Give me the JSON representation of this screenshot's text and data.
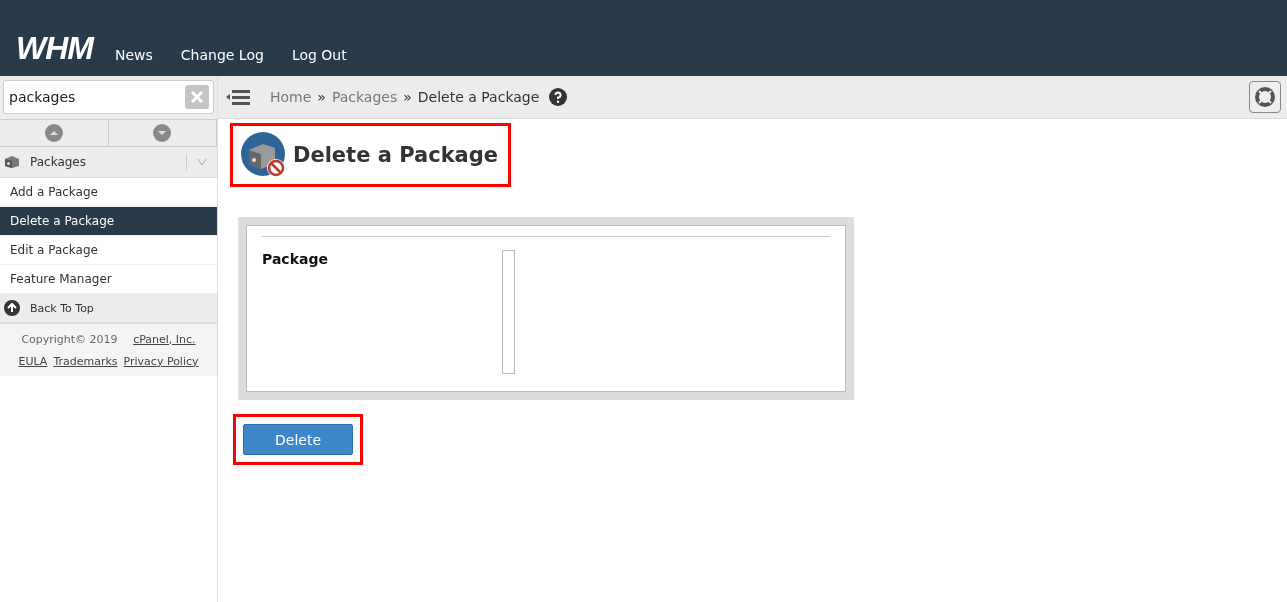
{
  "header": {
    "logo": "WHM",
    "nav": [
      "News",
      "Change Log",
      "Log Out"
    ]
  },
  "search": {
    "value": "packages"
  },
  "breadcrumb": {
    "items": [
      "Home",
      "Packages",
      "Delete a Package"
    ],
    "separator": "»"
  },
  "sidebar": {
    "group": {
      "label": "Packages",
      "expanded": true
    },
    "items": [
      {
        "label": "Add a Package",
        "selected": false
      },
      {
        "label": "Delete a Package",
        "selected": true
      },
      {
        "label": "Edit a Package",
        "selected": false
      },
      {
        "label": "Feature Manager",
        "selected": false
      }
    ],
    "back_to_top": "Back To Top",
    "footer": {
      "copyright": "Copyright© 2019",
      "company_link": "cPanel, Inc.",
      "links": [
        "EULA",
        "Trademarks",
        "Privacy Policy"
      ]
    }
  },
  "page": {
    "title": "Delete a Package",
    "title_highlighted": true,
    "field_label": "Package",
    "button": "Delete",
    "button_highlighted": true
  }
}
